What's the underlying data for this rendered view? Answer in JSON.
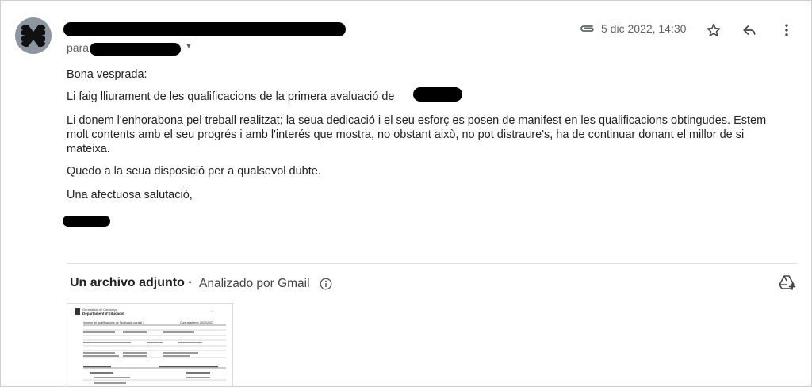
{
  "email": {
    "to_label": "para",
    "date": "5 dic 2022, 14:30",
    "body": {
      "greeting": "Bona vesprada:",
      "line1": "Li faig lliurament de les qualificacions de la primera avaluació de",
      "line2": "Li donem l'enhorabona pel treball realitzat; la seua dedicació i el seu esforç es posen de manifest en les qualificacions obtingudes. Estem molt contents amb el seu progrés i amb l'interés que mostra, no obstant això, no pot distraure's, ha de continuar donant el millor de si mateixa.",
      "line3": "Quedo a la seua disposició per a qualsevol dubte.",
      "closing": "Una afectuosa salutació,"
    }
  },
  "attachments": {
    "title": "Un archivo adjunto",
    "scanned": "Analizado por Gmail",
    "thumbnail": {
      "org": "Generalitat de Catalunya",
      "dept": "Departament d'Educació",
      "doc_title": "Informe de qualificacions de l'avaluació parcial 1",
      "course": "Curs acadèmic 2022/2023"
    }
  },
  "icons": {
    "attachment": "paperclip-icon",
    "star": "star-icon",
    "reply": "reply-icon",
    "more": "more-vert-icon",
    "info": "info-icon",
    "drive": "add-to-drive-icon"
  }
}
